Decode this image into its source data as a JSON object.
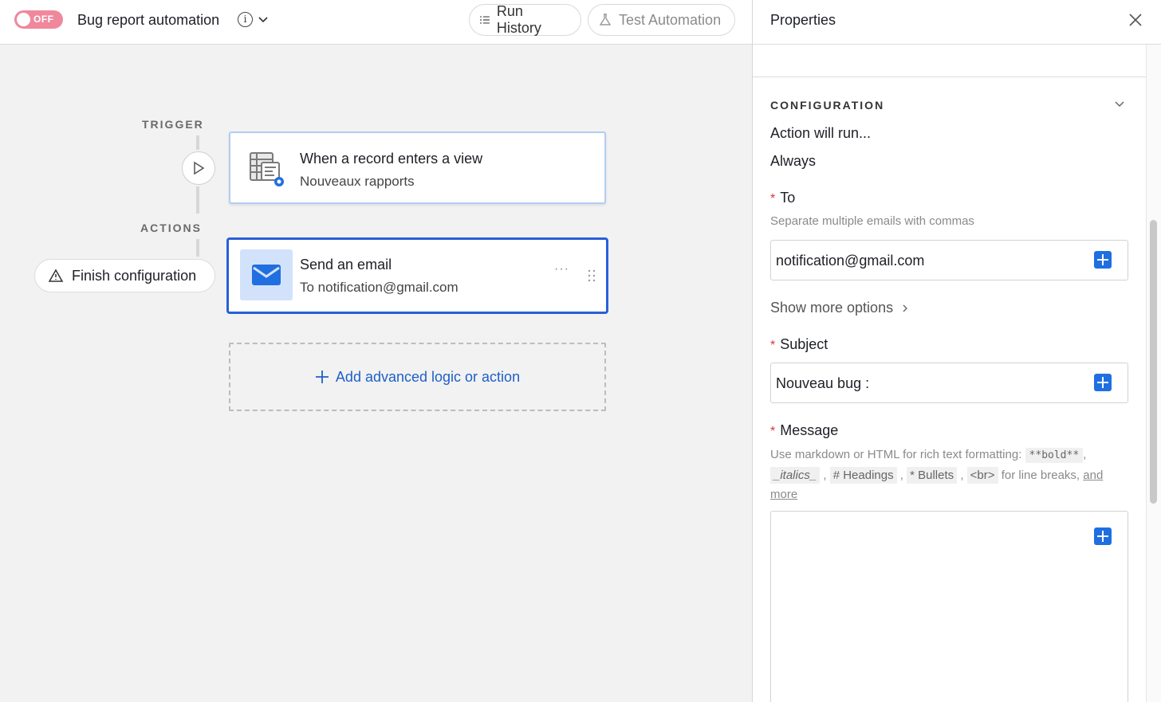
{
  "header": {
    "toggle_label": "OFF",
    "title": "Bug report automation",
    "info_icon": "info-icon",
    "run_history_label": "Run History",
    "test_automation_label": "Test Automation"
  },
  "canvas": {
    "trigger_label": "TRIGGER",
    "actions_label": "ACTIONS",
    "trigger_card": {
      "title": "When a record enters a view",
      "subtitle": "Nouveaux rapports"
    },
    "action_card": {
      "title": "Send an email",
      "subtitle": "To notification@gmail.com",
      "menu": "···"
    },
    "finish_button_label": "Finish configuration",
    "add_label": "Add advanced logic or action"
  },
  "panel": {
    "title": "Properties",
    "config_heading": "CONFIGURATION",
    "action_runs_label": "Action will run...",
    "action_runs_value": "Always",
    "to": {
      "required_mark": "*",
      "label": "To",
      "hint": "Separate multiple emails with commas",
      "value": "notification@gmail.com"
    },
    "show_more_label": "Show more options",
    "subject": {
      "required_mark": "*",
      "label": "Subject",
      "value": "Nouveau bug :"
    },
    "message": {
      "required_mark": "*",
      "label": "Message",
      "hint_prefix": "Use markdown or HTML for rich text formatting:",
      "code_bold": "**bold**",
      "code_italics": "_italics_",
      "code_headings": "# Headings",
      "code_bullets": "* Bullets",
      "code_br": "<br>",
      "for_line_breaks": "for line breaks,",
      "and_more": "and more",
      "sep": ","
    }
  },
  "colors": {
    "toggle_off": "#f0889c",
    "accent_blue": "#1f6fe0",
    "selected_border": "#2860d8"
  }
}
